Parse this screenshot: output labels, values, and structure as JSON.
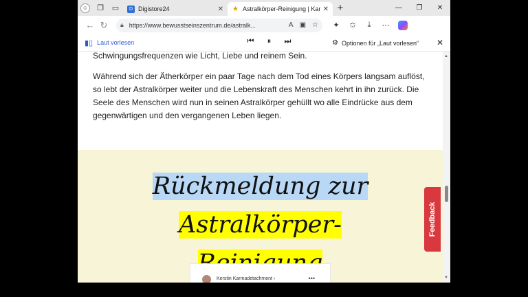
{
  "tabs": [
    {
      "title": "Digistore24",
      "favicon": "D",
      "active": false
    },
    {
      "title": "Astralkörper-Reinigung | Karm",
      "favicon": "★",
      "active": true
    }
  ],
  "address": {
    "url": "https://www.bewusstseinszentrum.de/astralk..."
  },
  "read_aloud": {
    "label": "Laut vorlesen",
    "options_label": "Optionen für „Laut vorlesen“"
  },
  "article": {
    "para1": "Schwingungsfrequenzen wie Licht, Liebe und reinem Sein.",
    "para2": "Während sich der Ätherkörper ein paar Tage nach dem Tod eines Körpers langsam auflöst, so lebt der Astralkörper weiter und die Lebenskraft des Menschen kehrt in ihn zurück. Die Seele des Menschen wird nun in seinen Astralkörper gehüllt wo alle Eindrücke aus dem gegenwärtigen und den vergangenen Leben liegen.",
    "headline_part1": "Rückmeldung zur ",
    "headline_part2": "Astralkörper-",
    "headline_part3": "Reinigung",
    "card_name": "Kerstin Karmadetachment ›",
    "card_more": "•••"
  },
  "feedback_label": "Feedback",
  "colors": {
    "highlight_blue": "#b8d8f5",
    "highlight_yellow": "#ffff00",
    "feedback_red": "#d9393e",
    "feature_bg": "#f8f4d8"
  }
}
